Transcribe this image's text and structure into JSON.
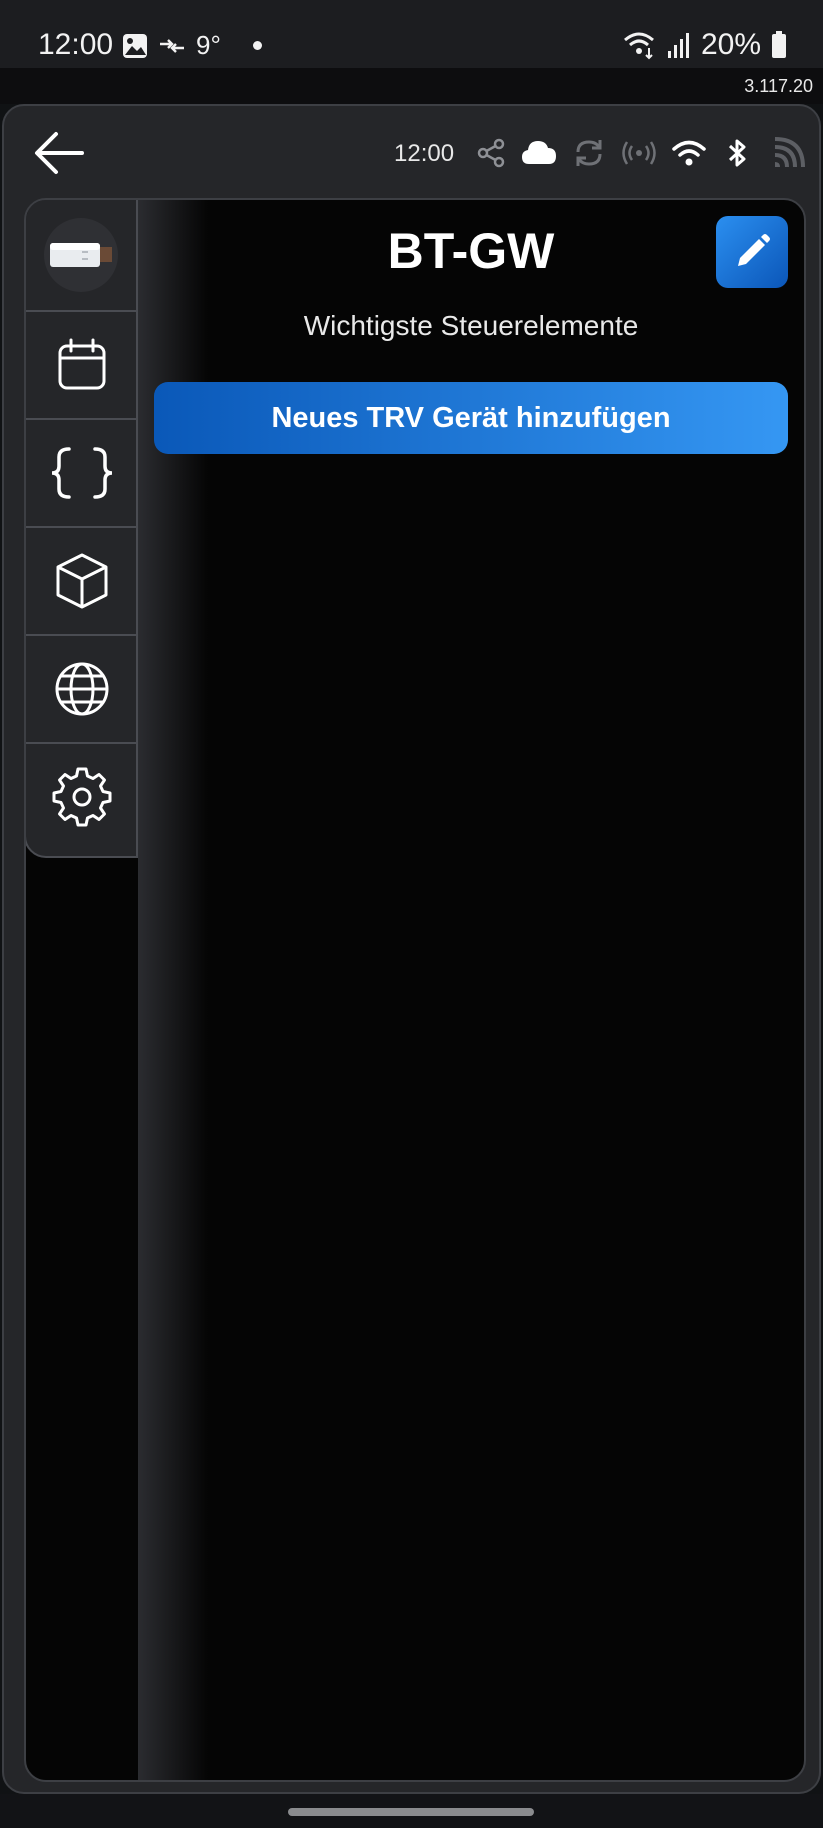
{
  "status_bar": {
    "time": "12:00",
    "temperature": "9°",
    "battery": "20%",
    "icons": [
      "gallery-icon",
      "data-transfer-icon",
      "notification-dot",
      "wifi-calling-icon",
      "signal-icon",
      "battery-icon"
    ]
  },
  "app_version": "3.117.20",
  "top_bar": {
    "time": "12:00",
    "icons": [
      "back-arrow-icon",
      "share-icon",
      "cloud-icon",
      "sync-icon",
      "broadcast-icon",
      "wifi-icon",
      "bluetooth-icon",
      "rss-icon"
    ]
  },
  "sidebar": {
    "items": [
      {
        "name": "device-avatar",
        "icon": "usb-dongle-icon"
      },
      {
        "name": "schedule",
        "icon": "calendar-icon"
      },
      {
        "name": "code",
        "icon": "curly-braces-icon"
      },
      {
        "name": "devices",
        "icon": "cube-icon"
      },
      {
        "name": "network",
        "icon": "globe-icon"
      },
      {
        "name": "settings",
        "icon": "gear-icon"
      }
    ]
  },
  "device": {
    "title": "BT-GW",
    "subtitle": "Wichtigste Steuerelemente",
    "add_button_label": "Neues TRV Gerät hinzufügen"
  },
  "colors": {
    "accent_blue": "#1f78dd",
    "background": "#050505",
    "panel": "#252629"
  }
}
